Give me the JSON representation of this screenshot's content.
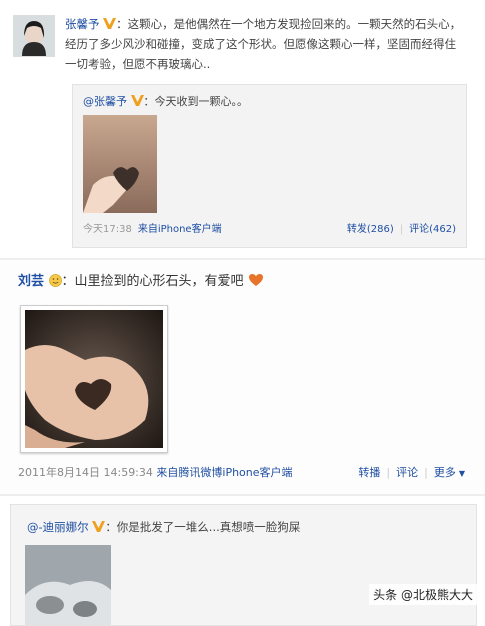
{
  "post1": {
    "username": "张馨予",
    "content": "：这颗心，是他偶然在一个地方发现捡回来的。一颗天然的石头心，经历了多少风沙和碰撞，变成了这个形状。但愿像这颗心一样，坚固而经得住一切考验，但愿不再玻璃心..",
    "repost": {
      "username": "@张馨予",
      "content": "：今天收到一颗心。。"
    },
    "time": "今天17:38",
    "source": "来自iPhone客户端",
    "repost_label": "转发(286)",
    "comment_label": "评论(462)"
  },
  "post2": {
    "username": "刘芸",
    "content": "：山里捡到的心形石头，有爱吧",
    "time": "2011年8月14日 14:59:34",
    "source": "来自腾讯微博iPhone客户端",
    "repost_label": "转播",
    "comment_label": "评论",
    "more_label": "更多"
  },
  "post3": {
    "username": "@-迪丽娜尔",
    "content": "：你是批发了一堆么...真想喷一脸狗屎"
  },
  "watermark": "头条 @北极熊大大",
  "colors": {
    "link": "#1f4fa3",
    "vip_badge": "#f0a020",
    "heart": "#e8742a"
  }
}
